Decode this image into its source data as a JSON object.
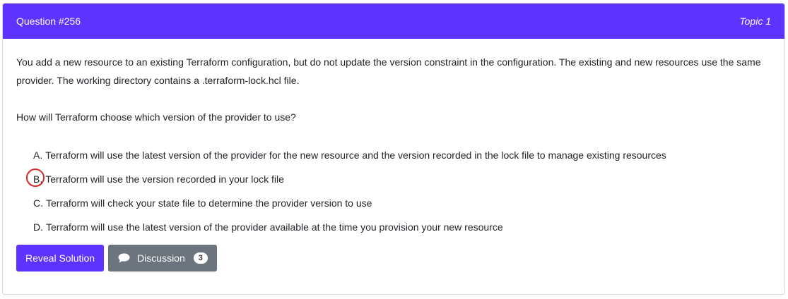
{
  "header": {
    "question_number": "Question #256",
    "topic": "Topic 1",
    "accent_color": "#5c33ff"
  },
  "question": {
    "text": "You add a new resource to an existing Terraform configuration, but do not update the version constraint in the configuration. The existing and new resources use the same provider. The working directory contains a .terraform-lock.hcl file.",
    "ask": "How will Terraform choose which version of the provider to use?"
  },
  "choices": [
    {
      "letter": "A.",
      "text": "Terraform will use the latest version of the provider for the new resource and the version recorded in the lock file to manage existing resources"
    },
    {
      "letter": "B.",
      "text": "Terraform will use the version recorded in your lock file",
      "marked": true
    },
    {
      "letter": "C.",
      "text": "Terraform will check your state file to determine the provider version to use"
    },
    {
      "letter": "D.",
      "text": "Terraform will use the latest version of the provider available at the time you provision your new resource"
    }
  ],
  "actions": {
    "reveal_label": "Reveal Solution",
    "discussion_label": "Discussion",
    "discussion_count": "3",
    "discussion_icon": "chat-bubble-icon"
  },
  "colors": {
    "marker": "#d22b2b",
    "secondary_button": "#6c757d"
  }
}
